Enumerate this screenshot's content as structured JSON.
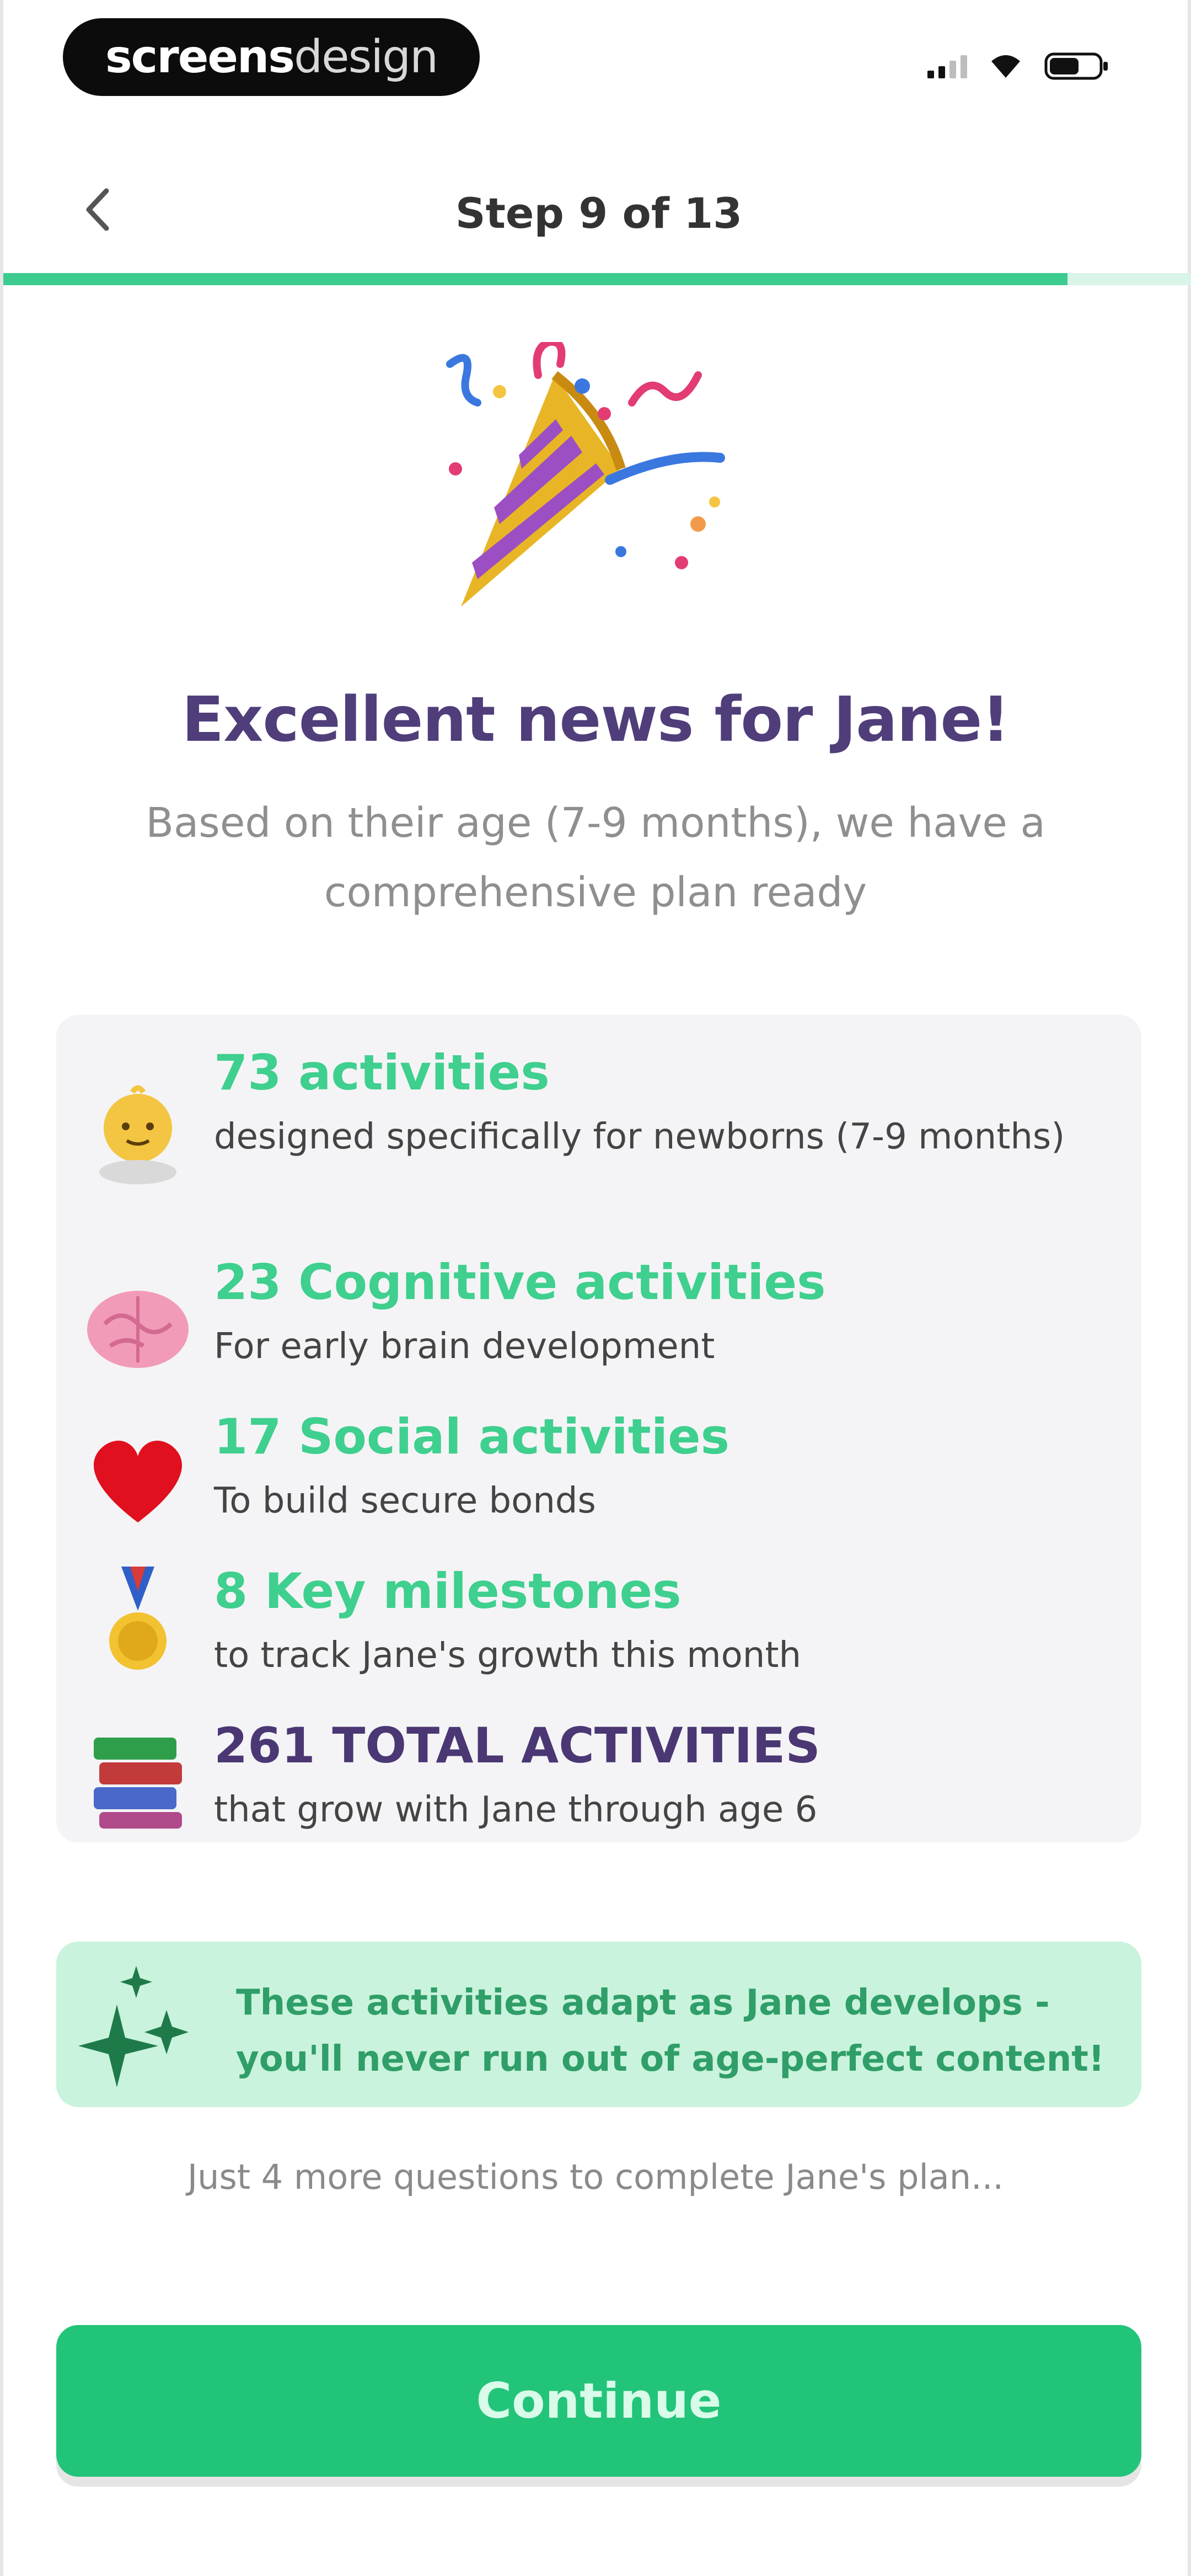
{
  "status_bar": {
    "watermark_bold": "screens",
    "watermark_light": "design",
    "icons": [
      "cellular-signal-icon",
      "wifi-icon",
      "battery-icon"
    ]
  },
  "nav": {
    "back_icon": "chevron-left-icon",
    "title": "Step 9 of 13",
    "progress_fraction": 0.8936
  },
  "hero": {
    "icon": "party-popper-icon",
    "headline": "Excellent news for Jane!",
    "subtitle": "Based on their age (7-9 months), we have a comprehensive plan ready"
  },
  "summary": {
    "items": [
      {
        "icon": "baby-icon",
        "title": "73 activities",
        "desc": "designed specifically for newborns (7-9 months)",
        "emphasis": false
      },
      {
        "icon": "brain-icon",
        "title": "23 Cognitive activities",
        "desc": "For early brain development",
        "emphasis": false
      },
      {
        "icon": "heart-icon",
        "title": "17 Social activities",
        "desc": "To build secure bonds",
        "emphasis": false
      },
      {
        "icon": "medal-icon",
        "title": "8 Key milestones",
        "desc": "to track Jane's growth this month",
        "emphasis": false
      },
      {
        "icon": "books-icon",
        "title": "261 TOTAL ACTIVITIES",
        "desc": "that grow with Jane through age 6",
        "emphasis": true
      }
    ]
  },
  "banner": {
    "icon": "sparkles-icon",
    "text": "These activities adapt as Jane develops - you'll never run out of age-perfect content!"
  },
  "footnote": "Just 4 more questions to complete Jane's plan...",
  "cta": {
    "label": "Continue"
  },
  "colors": {
    "accent_green": "#22c47a",
    "title_purple": "#4f3e7a",
    "banner_bg": "#c9f3dc"
  }
}
